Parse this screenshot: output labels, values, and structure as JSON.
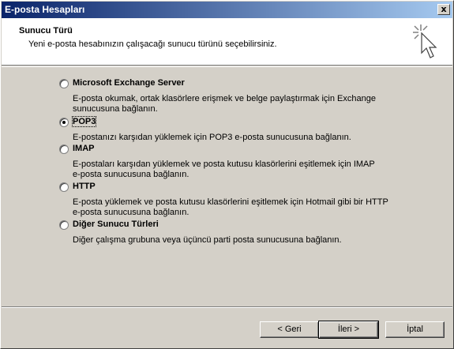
{
  "window": {
    "title": "E-posta Hesapları",
    "close_label": "x"
  },
  "header": {
    "title": "Sunucu Türü",
    "subtitle": "Yeni e-posta hesabınızın çalışacağı sunucu türünü seçebilirsiniz."
  },
  "options": [
    {
      "label": "Microsoft Exchange Server",
      "desc1": "E-posta okumak, ortak klasörlere erişmek ve belge paylaştırmak için Exchange",
      "desc2": "sunucusuna bağlanın.",
      "checked": false
    },
    {
      "label": "POP3",
      "desc1": "E-postanızı karşıdan yüklemek için POP3 e-posta sunucusuna bağlanın.",
      "desc2": "",
      "checked": true
    },
    {
      "label": "IMAP",
      "desc1": "E-postaları karşıdan yüklemek ve posta kutusu klasörlerini eşitlemek için IMAP",
      "desc2": "e-posta sunucusuna bağlanın.",
      "checked": false
    },
    {
      "label": "HTTP",
      "desc1": "E-posta yüklemek ve posta kutusu klasörlerini eşitlemek için Hotmail gibi bir HTTP",
      "desc2": "e-posta sunucusuna bağlanın.",
      "checked": false
    },
    {
      "label": "Diğer Sunucu Türleri",
      "desc1": "Diğer çalışma grubuna veya üçüncü parti posta sunucusuna bağlanın.",
      "desc2": "",
      "checked": false
    }
  ],
  "buttons": {
    "back": "< Geri",
    "next": "İleri >",
    "cancel": "İptal"
  },
  "colors": {
    "titlebar_start": "#0a246a",
    "titlebar_end": "#a6caf0",
    "face": "#d4d0c8"
  },
  "icons": {
    "header": "cursor-sparkle-icon"
  }
}
